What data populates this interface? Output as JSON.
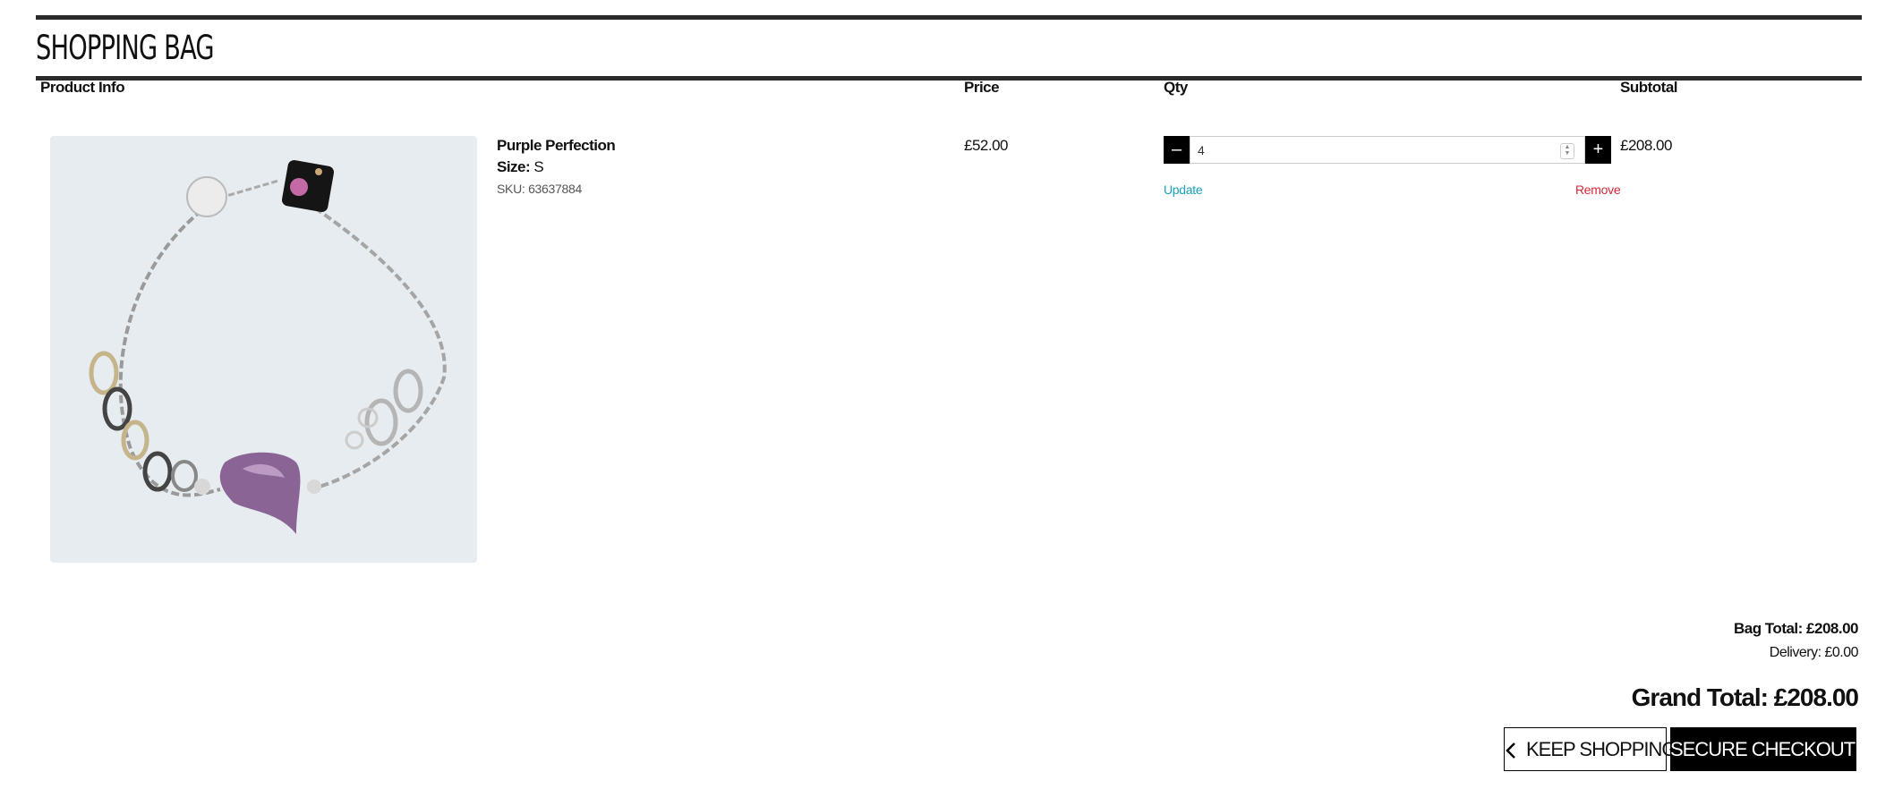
{
  "page": {
    "title": "SHOPPING BAG"
  },
  "table": {
    "headers": {
      "product_info": "Product Info",
      "price": "Price",
      "qty": "Qty",
      "subtotal": "Subtotal"
    }
  },
  "item": {
    "name": "Purple Perfection",
    "size_label": "Size:",
    "size_value": "S",
    "sku": "SKU: 63637884",
    "price": "£52.00",
    "qty": "4",
    "subtotal": "£208.00",
    "update_label": "Update",
    "remove_label": "Remove",
    "image_icon": "bracelet-product-image"
  },
  "summary": {
    "bag_total": "Bag Total: £208.00",
    "delivery": "Delivery: £0.00",
    "grand_total": "Grand Total: £208.00"
  },
  "actions": {
    "keep_shopping": "KEEP SHOPPING",
    "secure_checkout": "SECURE CHECKOUT",
    "keep_icon": "chevron-left-icon",
    "secure_icon": "lock-icon"
  },
  "colors": {
    "update_link": "#1aa0b8",
    "remove_link": "#d52a3a",
    "button_dark": "#000000"
  }
}
